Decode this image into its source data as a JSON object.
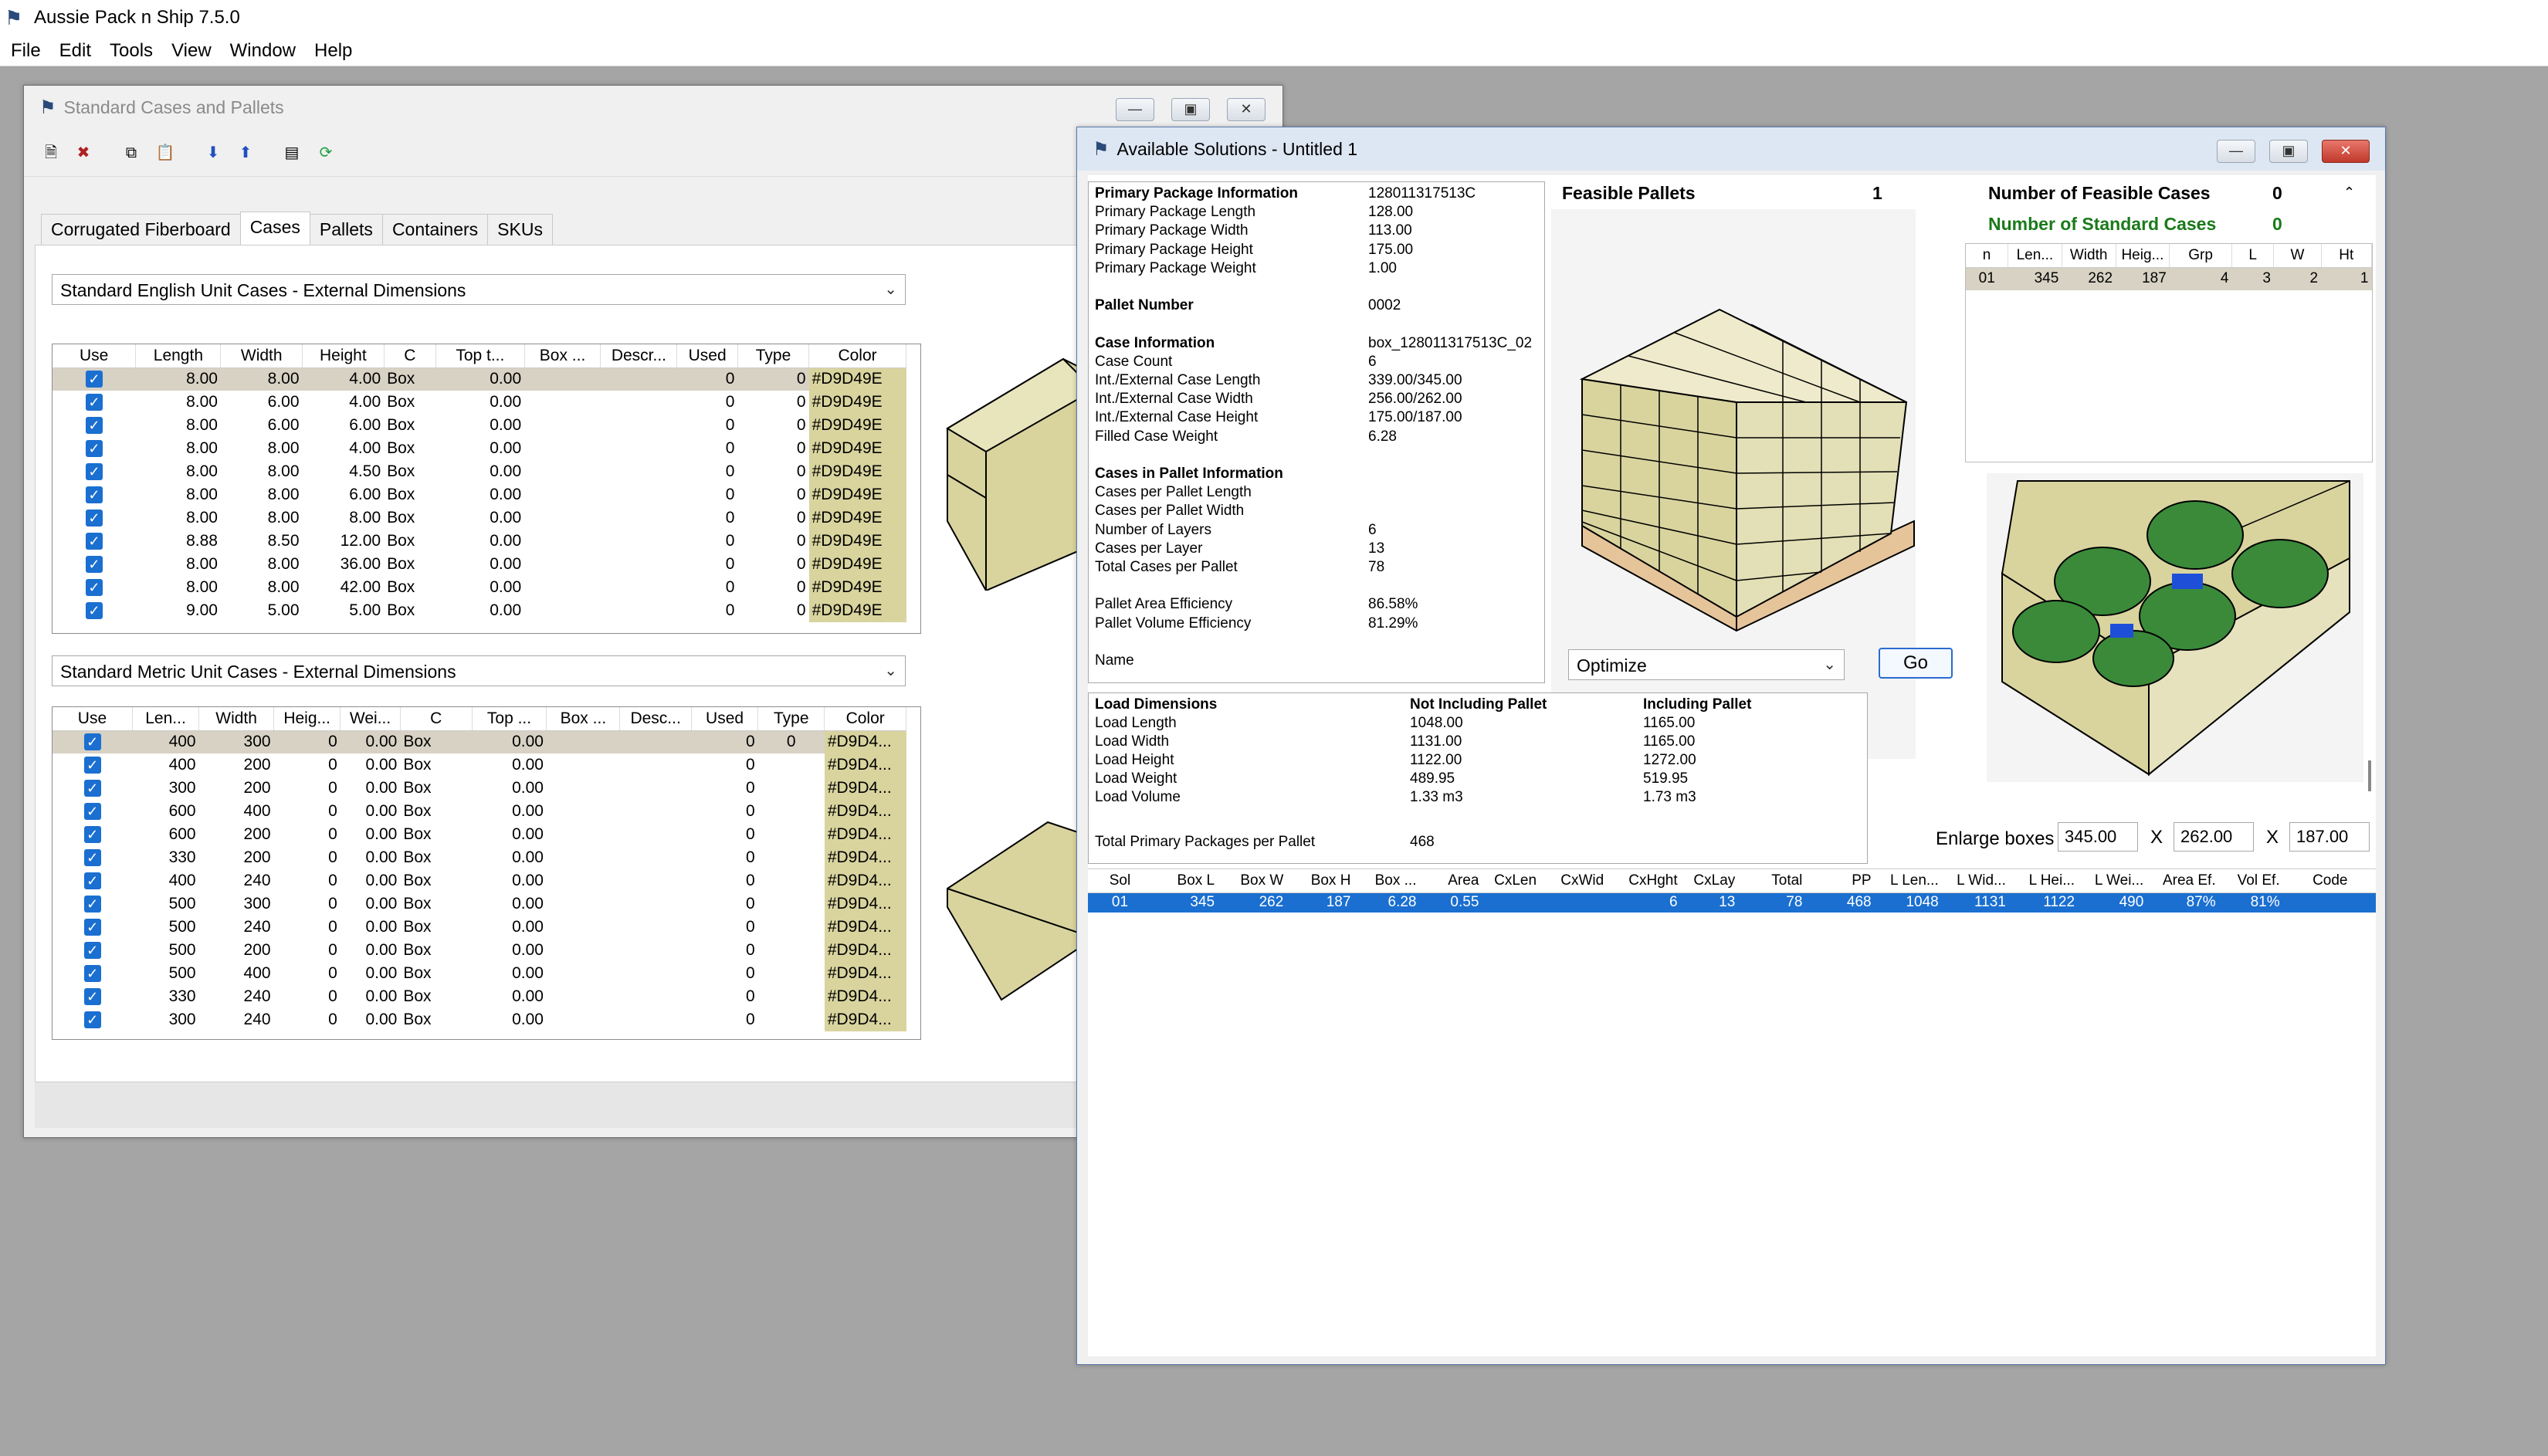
{
  "app": {
    "title": "Aussie Pack n Ship 7.5.0"
  },
  "menu": [
    "File",
    "Edit",
    "Tools",
    "View",
    "Window",
    "Help"
  ],
  "cases_window": {
    "title": "Standard Cases and Pallets",
    "tabs": [
      "Corrugated Fiberboard",
      "Cases",
      "Pallets",
      "Containers",
      "SKUs"
    ],
    "active_tab": "Cases",
    "english_combo": "Standard English Unit Cases - External Dimensions",
    "metric_combo": "Standard Metric Unit Cases - External Dimensions",
    "english_headers": [
      "Use",
      "Length",
      "Width",
      "Height",
      "C",
      "Top t...",
      "Box ...",
      "Descr...",
      "Used",
      "Type",
      "Color"
    ],
    "english_rows": [
      [
        "8.00",
        "8.00",
        "4.00",
        "Box",
        "0.00",
        "",
        "",
        "0",
        "0",
        "#D9D49E"
      ],
      [
        "8.00",
        "6.00",
        "4.00",
        "Box",
        "0.00",
        "",
        "",
        "0",
        "0",
        "#D9D49E"
      ],
      [
        "8.00",
        "6.00",
        "6.00",
        "Box",
        "0.00",
        "",
        "",
        "0",
        "0",
        "#D9D49E"
      ],
      [
        "8.00",
        "8.00",
        "4.00",
        "Box",
        "0.00",
        "",
        "",
        "0",
        "0",
        "#D9D49E"
      ],
      [
        "8.00",
        "8.00",
        "4.50",
        "Box",
        "0.00",
        "",
        "",
        "0",
        "0",
        "#D9D49E"
      ],
      [
        "8.00",
        "8.00",
        "6.00",
        "Box",
        "0.00",
        "",
        "",
        "0",
        "0",
        "#D9D49E"
      ],
      [
        "8.00",
        "8.00",
        "8.00",
        "Box",
        "0.00",
        "",
        "",
        "0",
        "0",
        "#D9D49E"
      ],
      [
        "8.88",
        "8.50",
        "12.00",
        "Box",
        "0.00",
        "",
        "",
        "0",
        "0",
        "#D9D49E"
      ],
      [
        "8.00",
        "8.00",
        "36.00",
        "Box",
        "0.00",
        "",
        "",
        "0",
        "0",
        "#D9D49E"
      ],
      [
        "8.00",
        "8.00",
        "42.00",
        "Box",
        "0.00",
        "",
        "",
        "0",
        "0",
        "#D9D49E"
      ],
      [
        "9.00",
        "5.00",
        "5.00",
        "Box",
        "0.00",
        "",
        "",
        "0",
        "0",
        "#D9D49E"
      ]
    ],
    "metric_headers": [
      "Use",
      "Len...",
      "Width",
      "Heig...",
      "Wei...",
      "C",
      "Top ...",
      "Box ...",
      "Desc...",
      "Used",
      "Type",
      "Color"
    ],
    "metric_rows": [
      [
        "400",
        "300",
        "0",
        "0.00",
        "Box",
        "0.00",
        "",
        "",
        "0",
        "0",
        "#D9D4..."
      ],
      [
        "400",
        "200",
        "0",
        "0.00",
        "Box",
        "0.00",
        "",
        "",
        "0",
        "",
        "#D9D4..."
      ],
      [
        "300",
        "200",
        "0",
        "0.00",
        "Box",
        "0.00",
        "",
        "",
        "0",
        "",
        "#D9D4..."
      ],
      [
        "600",
        "400",
        "0",
        "0.00",
        "Box",
        "0.00",
        "",
        "",
        "0",
        "",
        "#D9D4..."
      ],
      [
        "600",
        "200",
        "0",
        "0.00",
        "Box",
        "0.00",
        "",
        "",
        "0",
        "",
        "#D9D4..."
      ],
      [
        "330",
        "200",
        "0",
        "0.00",
        "Box",
        "0.00",
        "",
        "",
        "0",
        "",
        "#D9D4..."
      ],
      [
        "400",
        "240",
        "0",
        "0.00",
        "Box",
        "0.00",
        "",
        "",
        "0",
        "",
        "#D9D4..."
      ],
      [
        "500",
        "300",
        "0",
        "0.00",
        "Box",
        "0.00",
        "",
        "",
        "0",
        "",
        "#D9D4..."
      ],
      [
        "500",
        "240",
        "0",
        "0.00",
        "Box",
        "0.00",
        "",
        "",
        "0",
        "",
        "#D9D4..."
      ],
      [
        "500",
        "200",
        "0",
        "0.00",
        "Box",
        "0.00",
        "",
        "",
        "0",
        "",
        "#D9D4..."
      ],
      [
        "500",
        "400",
        "0",
        "0.00",
        "Box",
        "0.00",
        "",
        "",
        "0",
        "",
        "#D9D4..."
      ],
      [
        "330",
        "240",
        "0",
        "0.00",
        "Box",
        "0.00",
        "",
        "",
        "0",
        "",
        "#D9D4..."
      ],
      [
        "300",
        "240",
        "0",
        "0.00",
        "Box",
        "0.00",
        "",
        "",
        "0",
        "",
        "#D9D4..."
      ]
    ]
  },
  "solutions_window": {
    "title": "Available Solutions - Untitled 1",
    "info": [
      [
        "Primary Package Information",
        "128011317513C",
        true
      ],
      [
        "Primary Package Length",
        "128.00",
        false
      ],
      [
        "Primary Package Width",
        "113.00",
        false
      ],
      [
        "Primary Package Height",
        "175.00",
        false
      ],
      [
        "Primary Package Weight",
        "1.00",
        false
      ],
      [
        "",
        "",
        false
      ],
      [
        "Pallet Number",
        "0002",
        true
      ],
      [
        "",
        "",
        false
      ],
      [
        "Case Information",
        "box_128011317513C_02",
        true
      ],
      [
        "Case Count",
        "6",
        false
      ],
      [
        "Int./External Case Length",
        "339.00/345.00",
        false
      ],
      [
        "Int./External Case Width",
        "256.00/262.00",
        false
      ],
      [
        "Int./External Case Height",
        "175.00/187.00",
        false
      ],
      [
        "Filled Case Weight",
        "6.28",
        false
      ],
      [
        "",
        "",
        false
      ],
      [
        "Cases in Pallet Information",
        "",
        true
      ],
      [
        "Cases per Pallet Length",
        "",
        false
      ],
      [
        "Cases per Pallet Width",
        "",
        false
      ],
      [
        "Number of Layers",
        "6",
        false
      ],
      [
        "Cases per Layer",
        "13",
        false
      ],
      [
        "Total Cases per Pallet",
        "78",
        false
      ],
      [
        "",
        "",
        false
      ],
      [
        "Pallet Area Efficiency",
        "86.58%",
        false
      ],
      [
        "Pallet Volume Efficiency",
        "81.29%",
        false
      ],
      [
        "",
        "",
        false
      ],
      [
        "Name",
        "",
        false
      ]
    ],
    "feasible_pallets_label": "Feasible Pallets",
    "feasible_pallets_count": "1",
    "optimize_select": "Optimize",
    "go_button": "Go",
    "num_feasible_cases_label": "Number of Feasible Cases",
    "num_feasible_cases": "0",
    "num_standard_cases_label": "Number of Standard Cases",
    "num_standard_cases": "0",
    "small_headers": [
      "n",
      "Len...",
      "Width",
      "Heig...",
      "Grp",
      "L",
      "W",
      "Ht"
    ],
    "small_row": [
      "01",
      "345",
      "262",
      "187",
      "4",
      "3",
      "2",
      "1"
    ],
    "load": {
      "headers": [
        "Load Dimensions",
        "Not Including Pallet",
        "Including Pallet"
      ],
      "rows": [
        [
          "Load Length",
          "1048.00",
          "1165.00"
        ],
        [
          "Load Width",
          "1131.00",
          "1165.00"
        ],
        [
          "Load Height",
          "1122.00",
          "1272.00"
        ],
        [
          "Load Weight",
          "489.95",
          "519.95"
        ],
        [
          "Load Volume",
          "1.33 m3",
          "1.73 m3"
        ]
      ],
      "total_label": "Total Primary Packages per Pallet",
      "total_value": "468"
    },
    "enlarge_label": "Enlarge boxes",
    "enlarge": [
      "345.00",
      "262.00",
      "187.00"
    ],
    "x_sep": "X",
    "results_headers": [
      "Sol",
      "Box L",
      "Box W",
      "Box H",
      "Box ...",
      "Area",
      "CxLen",
      "CxWid",
      "CxHght",
      "CxLay",
      "Total",
      "PP",
      "L Len...",
      "L Wid...",
      "L Hei...",
      "L Wei...",
      "Area Ef.",
      "Vol Ef.",
      "Code"
    ],
    "results_row": [
      "01",
      "345",
      "262",
      "187",
      "6.28",
      "0.55",
      "",
      "",
      "6",
      "13",
      "78",
      "468",
      "1048",
      "1131",
      "1122",
      "490",
      "87%",
      "81%",
      ""
    ]
  },
  "colors": {
    "case_tan": "#D9D49E",
    "select_blue": "#1a6fd0",
    "green_text": "#1a7a1a"
  }
}
